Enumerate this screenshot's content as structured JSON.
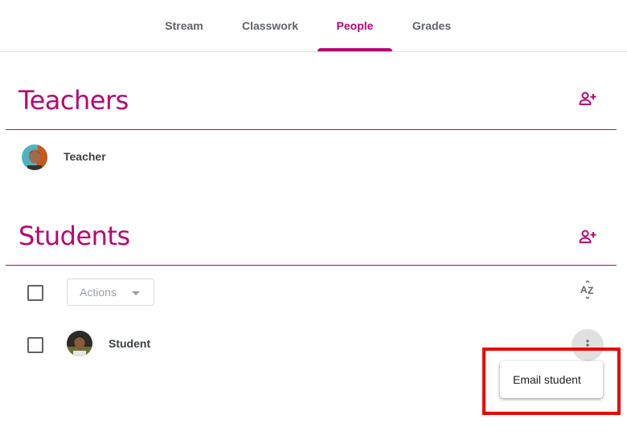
{
  "nav": {
    "tabs": [
      {
        "label": "Stream"
      },
      {
        "label": "Classwork"
      },
      {
        "label": "People"
      },
      {
        "label": "Grades"
      }
    ],
    "active_tab": "People"
  },
  "teachers": {
    "heading": "Teachers",
    "people": [
      {
        "name": "Teacher"
      }
    ],
    "invite_icon": "person-add-icon"
  },
  "students": {
    "heading": "Students",
    "invite_icon": "person-add-icon",
    "actions_label": "Actions",
    "sort_icon": "sort-az-icon",
    "people": [
      {
        "name": "Student"
      }
    ]
  },
  "menu": {
    "items": [
      {
        "label": "Email student"
      }
    ]
  },
  "colors": {
    "accent": "#b80672",
    "highlight": "#ee0000"
  }
}
